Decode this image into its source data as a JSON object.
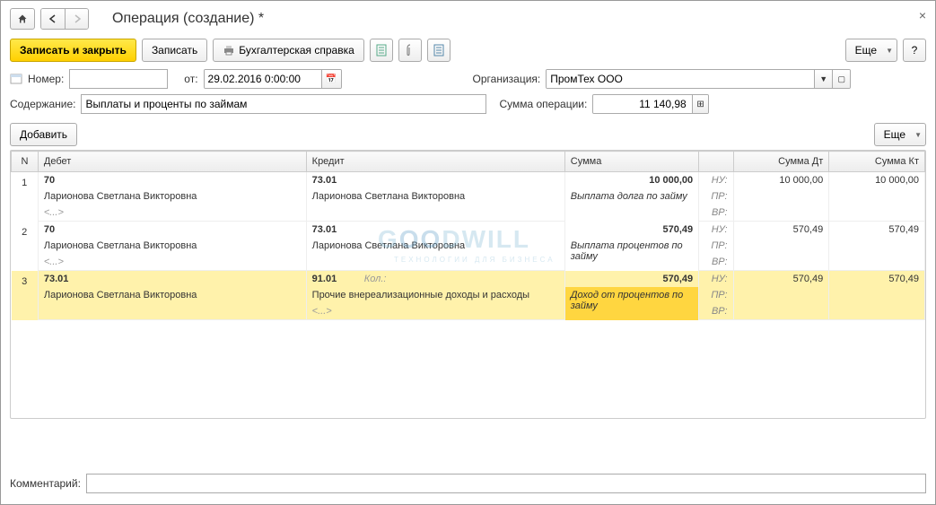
{
  "title": "Операция (создание) *",
  "toolbar": {
    "save_close": "Записать и закрыть",
    "save": "Записать",
    "print": "Бухгалтерская справка",
    "more": "Еще"
  },
  "form": {
    "number_label": "Номер:",
    "number_value": "",
    "from_label": "от:",
    "date_value": "29.02.2016 0:00:00",
    "org_label": "Организация:",
    "org_value": "ПромТех ООО",
    "content_label": "Содержание:",
    "content_value": "Выплаты и проценты по займам",
    "sum_label": "Сумма операции:",
    "sum_value": "11 140,98"
  },
  "table_toolbar": {
    "add": "Добавить",
    "more": "Еще"
  },
  "columns": {
    "n": "N",
    "debit": "Дебет",
    "credit": "Кредит",
    "sum": "Сумма",
    "sum_dt": "Сумма Дт",
    "sum_kt": "Сумма Кт"
  },
  "tax_labels": {
    "nu": "НУ:",
    "pr": "ПР:",
    "vr": "ВР:"
  },
  "rows": [
    {
      "n": "1",
      "debit_acc": "70",
      "debit_sub1": "Ларионова Светлана Викторовна",
      "debit_sub2": "<...>",
      "credit_acc": "73.01",
      "credit_sub1": "Ларионова Светлана Викторовна",
      "credit_sub2": "",
      "sum": "10 000,00",
      "sum_note": "Выплата долга по займу",
      "sum_dt": "10 000,00",
      "sum_kt": "10 000,00"
    },
    {
      "n": "2",
      "debit_acc": "70",
      "debit_sub1": "Ларионова Светлана Викторовна",
      "debit_sub2": "<...>",
      "credit_acc": "73.01",
      "credit_sub1": "Ларионова Светлана Викторовна",
      "credit_sub2": "",
      "sum": "570,49",
      "sum_note": "Выплата процентов по займу",
      "sum_dt": "570,49",
      "sum_kt": "570,49"
    },
    {
      "n": "3",
      "debit_acc": "73.01",
      "debit_sub1": "Ларионова Светлана Викторовна",
      "debit_sub2": "",
      "credit_acc": "91.01",
      "credit_qty": "Кол.:",
      "credit_sub1": "Прочие внереализационные доходы и расходы",
      "credit_sub2": "<...>",
      "sum": "570,49",
      "sum_note": "Доход от процентов по займу",
      "sum_dt": "570,49",
      "sum_kt": "570,49"
    }
  ],
  "comment_label": "Комментарий:",
  "comment_value": ""
}
